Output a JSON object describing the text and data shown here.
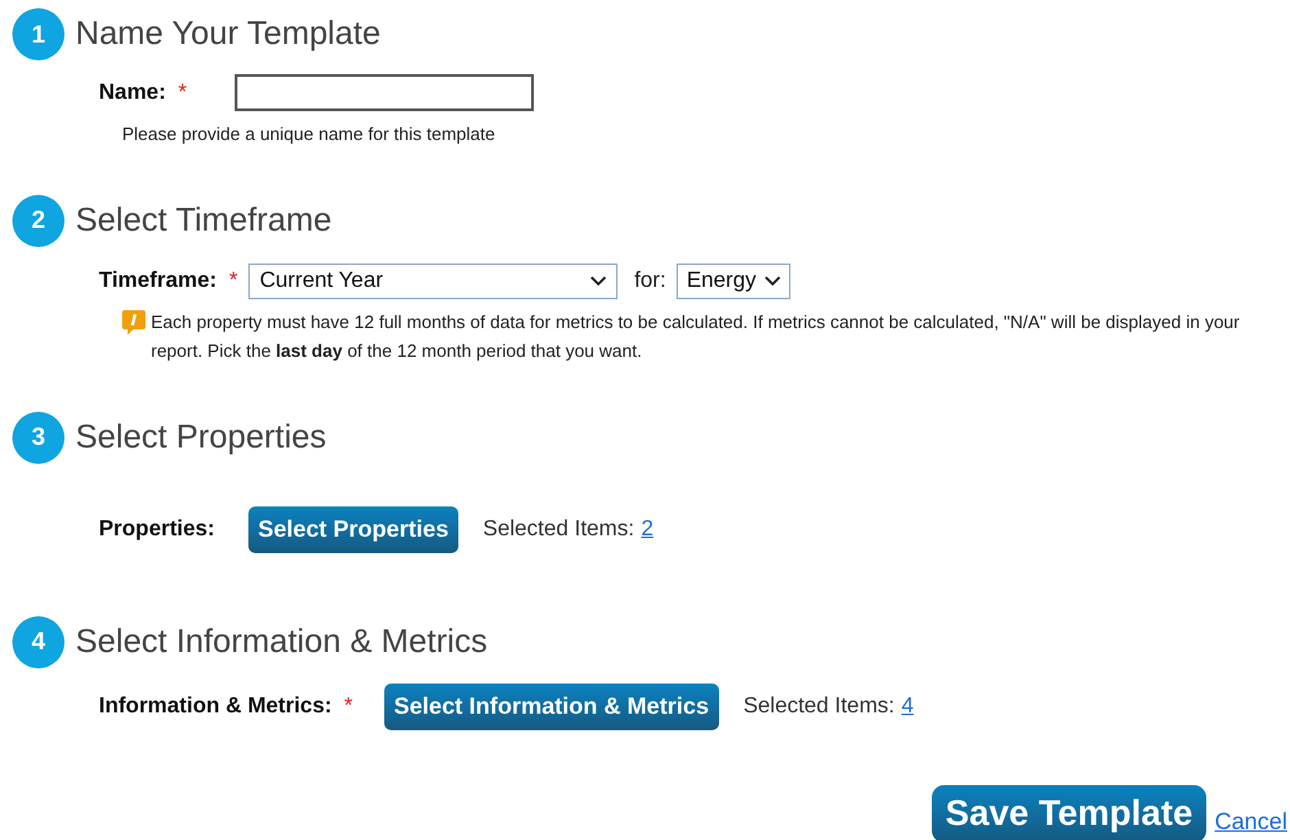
{
  "steps": [
    {
      "number": "1",
      "title": "Name Your Template",
      "kind": "name",
      "label": "Name:",
      "required_mark": "*",
      "hint": "Please provide a unique name for this template"
    },
    {
      "number": "2",
      "title": "Select Timeframe",
      "kind": "timeframe",
      "label": "Timeframe:",
      "required_mark": "*",
      "select": {
        "value": "Current Year"
      },
      "for_label": "for:",
      "for_select": {
        "value": "Energy"
      },
      "note": "Each property must have 12 full months of data for metrics to be calculated. If metrics cannot be calculated, \"N/A\" will be displayed in your report. Pick the **last day** of the 12 month period that you want."
    },
    {
      "number": "3",
      "title": "Select Properties",
      "kind": "picker",
      "label": "Properties:",
      "button": "Select Properties",
      "selected_label": "Selected Items:",
      "selected_count": "2"
    },
    {
      "number": "4",
      "title": "Select Information & Metrics",
      "kind": "picker",
      "label": "Information & Metrics:",
      "required_mark": "*",
      "button": "Select Information & Metrics",
      "selected_label": "Selected Items:",
      "selected_count": "4"
    }
  ],
  "actions": {
    "save": "Save Template",
    "cancel": "Cancel"
  }
}
